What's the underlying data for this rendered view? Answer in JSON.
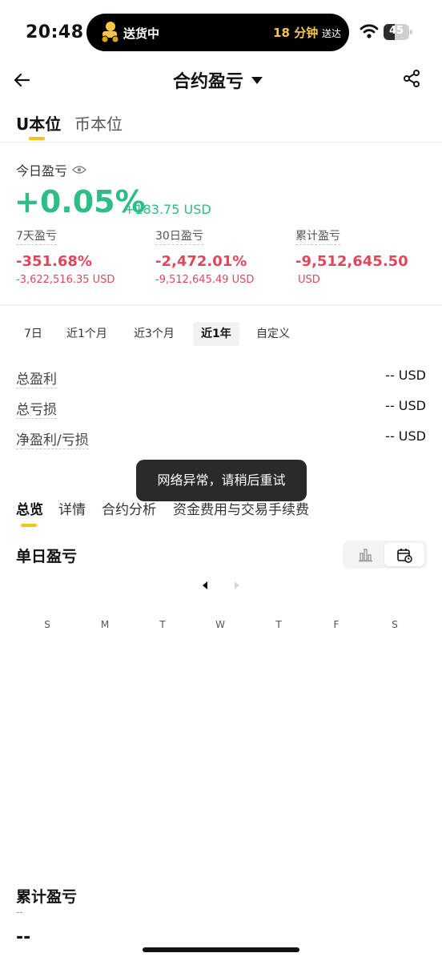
{
  "status_bar": {
    "time": "20:48",
    "delivery": "送货中",
    "eta_minutes": "18 分钟",
    "eta_suffix": "送达",
    "battery": "45",
    "battery_level": 0.45
  },
  "nav": {
    "title": "合约盈亏"
  },
  "unit_tabs": [
    {
      "label": "U本位",
      "active": true
    },
    {
      "label": "币本位",
      "active": false
    }
  ],
  "today": {
    "label": "今日盈亏",
    "percent": "+0.05%",
    "usd": "+183.75 USD"
  },
  "stats": [
    {
      "label": "7天盈亏",
      "percent": "-351.68%",
      "usd": "-3,622,516.35 USD"
    },
    {
      "label": "30日盈亏",
      "percent": "-2,472.01%",
      "usd": "-9,512,645.49 USD"
    },
    {
      "label": "累计盈亏",
      "percent": "-9,512,645.50",
      "usd": "USD"
    }
  ],
  "periods": [
    {
      "label": "7日",
      "active": false
    },
    {
      "label": "近1个月",
      "active": false
    },
    {
      "label": "近3个月",
      "active": false
    },
    {
      "label": "近1年",
      "active": true
    },
    {
      "label": "自定义",
      "active": false
    }
  ],
  "summary": [
    {
      "label": "总盈利",
      "value": "-- USD"
    },
    {
      "label": "总亏损",
      "value": "-- USD"
    },
    {
      "label": "净盈利/亏损",
      "value": "-- USD"
    }
  ],
  "toast": "网络异常，请稍后重试",
  "section_tabs": [
    {
      "label": "总览",
      "active": true
    },
    {
      "label": "详情",
      "active": false
    },
    {
      "label": "合约分析",
      "active": false
    },
    {
      "label": "资金费用与交易手续费",
      "active": false
    }
  ],
  "daily": {
    "title": "单日盈亏",
    "weekdays": [
      "S",
      "M",
      "T",
      "W",
      "T",
      "F",
      "S"
    ]
  },
  "cumulative": {
    "title": "累计盈亏",
    "sub": "--",
    "value": "--"
  },
  "colors": {
    "profit": "#2ebd85",
    "loss": "#e0475c",
    "accent": "#f0c419"
  }
}
